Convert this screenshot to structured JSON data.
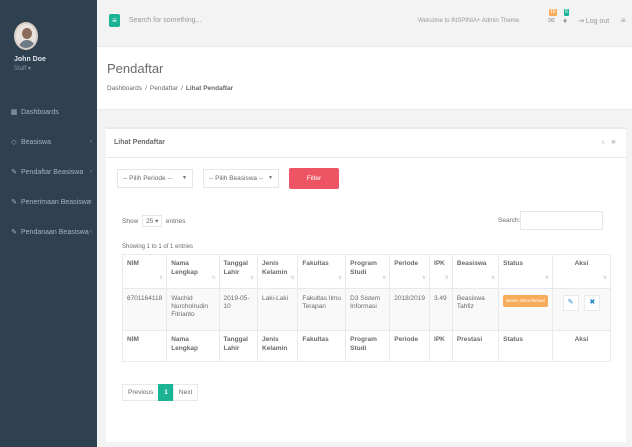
{
  "sidebar": {
    "profile": {
      "name": "John Doe",
      "role": "Staff ▾"
    },
    "items": [
      {
        "label": "Dashboards",
        "icon": "th-large-icon",
        "glyph": "▦",
        "has_chevron": false
      },
      {
        "label": "Beasiswa",
        "icon": "diamond-icon",
        "glyph": "◇",
        "chevron": "‹"
      },
      {
        "label": "Pendaftar Beasiswa",
        "icon": "edit-icon",
        "glyph": "✎",
        "chevron": "‹"
      },
      {
        "label": "Penerimaan Beasiswa",
        "icon": "edit-icon",
        "glyph": "✎",
        "chevron": "‹"
      },
      {
        "label": "Pendanaan Beasiswa",
        "icon": "edit-icon",
        "glyph": "✎",
        "chevron": "‹"
      }
    ]
  },
  "topbar": {
    "menu_glyph": "≡",
    "search_placeholder": "Search for something...",
    "welcome": "Welcome to INSPINIA+ Admin Theme.",
    "mail_badge": "16",
    "bell_badge": "8",
    "logout": "⇥ Log out",
    "tasks_glyph": "≡"
  },
  "heading": {
    "title": "Pendaftar",
    "breadcrumb": [
      "Dashboards",
      "Pendaftar",
      "Lihat Pendaftar"
    ],
    "separator": "/"
  },
  "panel": {
    "title": "Lihat Pendaftar",
    "tools": "∧ ✖",
    "filters": {
      "periode": "-- Pilih Periode --",
      "beasiswa": "-- Pilih Beasiswa --",
      "caret": "▼",
      "button": "Filter"
    },
    "show_prefix": "Show",
    "show_value": "25 ▾",
    "show_suffix": "entries",
    "search_label": "Search:",
    "info": "Showing 1 to 1 of 1 entries"
  },
  "table": {
    "headers": [
      "NIM",
      "Nama Lengkap",
      "Tanggal Lahir",
      "Jenis Kelamin",
      "Fakultas",
      "Program Studi",
      "Periode",
      "IPK",
      "Beasiswa",
      "Status",
      "Aksi"
    ],
    "row": {
      "nim": "6701164118",
      "nama": "Wachid Nurcholrudin Fitrianto",
      "tanggal": "2019-05-10",
      "jk": "Laki-Laki",
      "fakultas": "Fakultas Ilmu Terapan",
      "prodi": "D3 Sistem Informasi",
      "periode": "2018/2019",
      "ipk": "3.49",
      "beasiswa": "Beasiswa Tahfiz",
      "status": "Belum Dikonfirmasi",
      "edit_glyph": "✎",
      "delete_glyph": "✖"
    },
    "footers": [
      "NIM",
      "Nama Lengkap",
      "Tanggal Lahir",
      "Jenis Kelamin",
      "Fakultas",
      "Program Studi",
      "Periode",
      "IPK",
      "Prestasi",
      "Status",
      "Aksi"
    ]
  },
  "pagination": {
    "previous": "Previous",
    "current": "1",
    "next": "Next"
  }
}
